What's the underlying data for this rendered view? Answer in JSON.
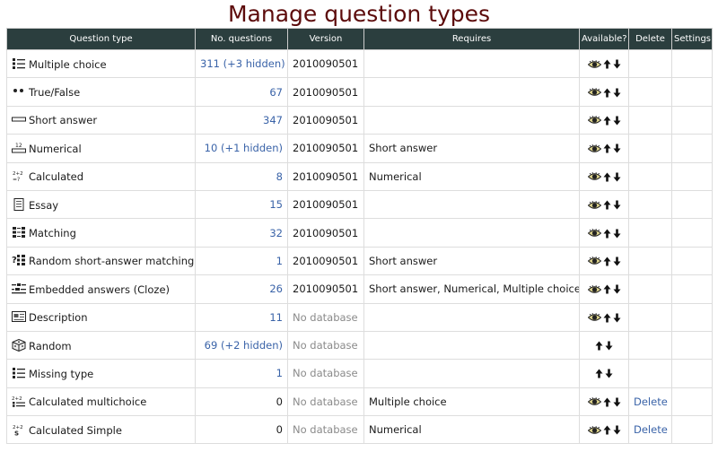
{
  "page": {
    "title": "Manage question types"
  },
  "table": {
    "headers": {
      "type": "Question type",
      "count": "No. questions",
      "version": "Version",
      "requires": "Requires",
      "available": "Available?",
      "delete": "Delete",
      "settings": "Settings"
    },
    "rows": [
      {
        "name": "Multiple choice",
        "icon": "multichoice-icon",
        "count": "311 (+3 hidden)",
        "version": "2010090501",
        "requires": "",
        "eye": true,
        "delete": ""
      },
      {
        "name": "True/False",
        "icon": "truefalse-icon",
        "count": "67",
        "version": "2010090501",
        "requires": "",
        "eye": true,
        "delete": ""
      },
      {
        "name": "Short answer",
        "icon": "shortanswer-icon",
        "count": "347",
        "version": "2010090501",
        "requires": "",
        "eye": true,
        "delete": ""
      },
      {
        "name": "Numerical",
        "icon": "numerical-icon",
        "count": "10 (+1 hidden)",
        "version": "2010090501",
        "requires": "Short answer",
        "eye": true,
        "delete": ""
      },
      {
        "name": "Calculated",
        "icon": "calculated-icon",
        "count": "8",
        "version": "2010090501",
        "requires": "Numerical",
        "eye": true,
        "delete": ""
      },
      {
        "name": "Essay",
        "icon": "essay-icon",
        "count": "15",
        "version": "2010090501",
        "requires": "",
        "eye": true,
        "delete": ""
      },
      {
        "name": "Matching",
        "icon": "matching-icon",
        "count": "32",
        "version": "2010090501",
        "requires": "",
        "eye": true,
        "delete": ""
      },
      {
        "name": "Random short-answer matching",
        "icon": "random-sa-matching-icon",
        "count": "1",
        "version": "2010090501",
        "requires": "Short answer",
        "eye": true,
        "delete": ""
      },
      {
        "name": "Embedded answers (Cloze)",
        "icon": "cloze-icon",
        "count": "26",
        "version": "2010090501",
        "requires": "Short answer, Numerical, Multiple choice",
        "eye": true,
        "delete": ""
      },
      {
        "name": "Description",
        "icon": "description-icon",
        "count": "11",
        "version": "No database",
        "requires": "",
        "eye": true,
        "delete": ""
      },
      {
        "name": "Random",
        "icon": "dice-icon",
        "count": "69 (+2 hidden)",
        "version": "No database",
        "requires": "",
        "eye": false,
        "delete": ""
      },
      {
        "name": "Missing type",
        "icon": "missingtype-icon",
        "count": "1",
        "version": "No database",
        "requires": "",
        "eye": false,
        "delete": ""
      },
      {
        "name": "Calculated multichoice",
        "icon": "calc-multichoice-icon",
        "count": "0",
        "version": "No database",
        "requires": "Multiple choice",
        "eye": true,
        "delete": "Delete"
      },
      {
        "name": "Calculated Simple",
        "icon": "calc-simple-icon",
        "count": "0",
        "version": "No database",
        "requires": "Numerical",
        "eye": true,
        "delete": "Delete"
      }
    ]
  }
}
